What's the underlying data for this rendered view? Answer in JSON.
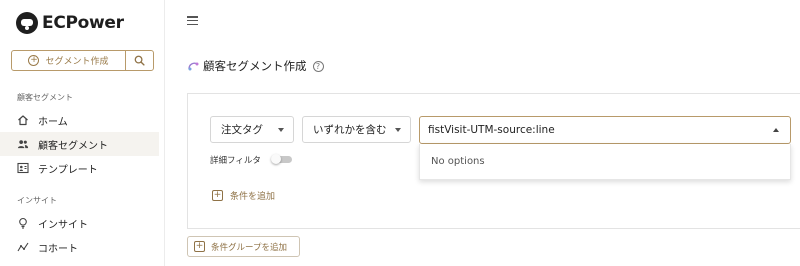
{
  "app": {
    "brand_name": "ECPower"
  },
  "sidebar": {
    "create_segment_label": "セグメント作成",
    "section_customer": "顧客セグメント",
    "section_insight": "インサイト",
    "items": [
      {
        "label": "ホーム",
        "icon": "home-icon",
        "active": false
      },
      {
        "label": "顧客セグメント",
        "icon": "users-icon",
        "active": true
      },
      {
        "label": "テンプレート",
        "icon": "template-icon",
        "active": false
      },
      {
        "label": "インサイト",
        "icon": "lightbulb-icon",
        "active": false
      },
      {
        "label": "コホート",
        "icon": "cohort-icon",
        "active": false
      }
    ]
  },
  "main": {
    "page_title": "顧客セグメント作成",
    "condition": {
      "field_select": "注文タグ",
      "operator_select": "いずれかを含む",
      "value_input": "fistVisit-UTM-source:line",
      "dropdown_message": "No options"
    },
    "detail_filter_label": "詳細フィルタ",
    "detail_filter_enabled": false,
    "add_condition_label": "条件を追加",
    "add_group_label": "条件グループを追加"
  },
  "colors": {
    "accent": "#9a7b4a",
    "accent_border": "#b89a6a",
    "active_bg": "#f5f3ef"
  }
}
